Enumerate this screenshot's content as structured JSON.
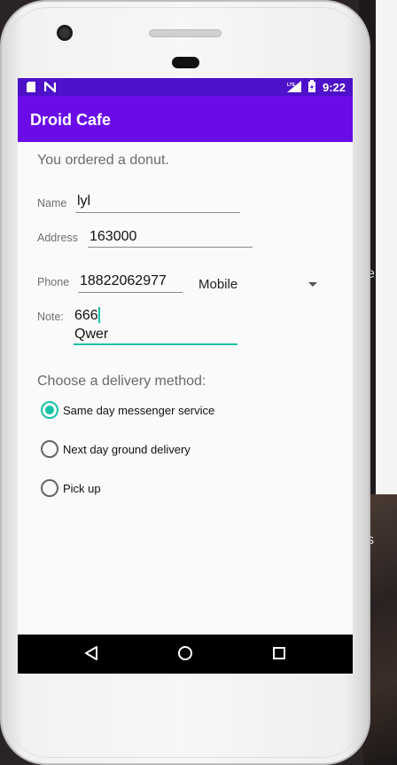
{
  "status_bar": {
    "time": "9:22",
    "icons": [
      "sd-card-icon",
      "notification-n-icon",
      "lte-signal-icon",
      "battery-icon"
    ]
  },
  "app_bar": {
    "title": "Droid Cafe"
  },
  "order": {
    "message": "You ordered a donut."
  },
  "form": {
    "name_label": "Name",
    "name_value": "lyl",
    "address_label": "Address",
    "address_value": "163000",
    "phone_label": "Phone",
    "phone_value": "18822062977",
    "phone_type_selected": "Mobile",
    "note_label": "Note:",
    "note_line1": "666",
    "note_line2": "Qwer"
  },
  "delivery": {
    "heading": "Choose a delivery method:",
    "options": [
      {
        "label": "Same day messenger service",
        "checked": true
      },
      {
        "label": "Next day ground delivery",
        "checked": false
      },
      {
        "label": "Pick up",
        "checked": false
      }
    ]
  },
  "nav_bar": {
    "icons": [
      "back-icon",
      "home-icon",
      "recents-icon"
    ]
  },
  "backdrop": {
    "fragment_1": "e",
    "fragment_2": "s"
  },
  "colors": {
    "status_bar": "#4c11c9",
    "app_bar": "#6a0ce8",
    "accent": "#19c3a8"
  }
}
